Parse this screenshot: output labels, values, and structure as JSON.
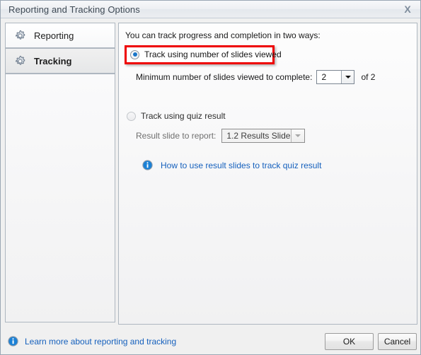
{
  "window": {
    "title": "Reporting and Tracking Options",
    "close_label": "X",
    "close_icon": "close-icon"
  },
  "sidebar": {
    "items": [
      {
        "label": "Reporting",
        "icon": "gear-icon",
        "selected": false
      },
      {
        "label": "Tracking",
        "icon": "gear-icon",
        "selected": true
      }
    ]
  },
  "content": {
    "intro": "You can track progress and completion in two ways:",
    "option_slides": {
      "label": "Track using number of slides viewed",
      "selected": true,
      "highlighted": true,
      "min_label": "Minimum number of slides viewed to complete:",
      "min_value": "2",
      "total_label": "of 2",
      "dropdown_icon": "chevron-down-icon"
    },
    "option_quiz": {
      "label": "Track using quiz result",
      "selected": false,
      "disabled": true,
      "result_label": "Result slide to report:",
      "result_value": "1.2 Results Slide",
      "dropdown_icon": "chevron-down-icon"
    },
    "help_link": {
      "text": "How to use result slides to track quiz result",
      "icon": "info-icon"
    }
  },
  "footer": {
    "learn_more": {
      "text": "Learn more about reporting and tracking",
      "icon": "info-icon"
    },
    "ok_label": "OK",
    "cancel_label": "Cancel"
  },
  "colors": {
    "highlight": "#ee0000",
    "link": "#1560bd",
    "radio_dot": "#1a76c8",
    "info_blue": "#1b81d6"
  }
}
